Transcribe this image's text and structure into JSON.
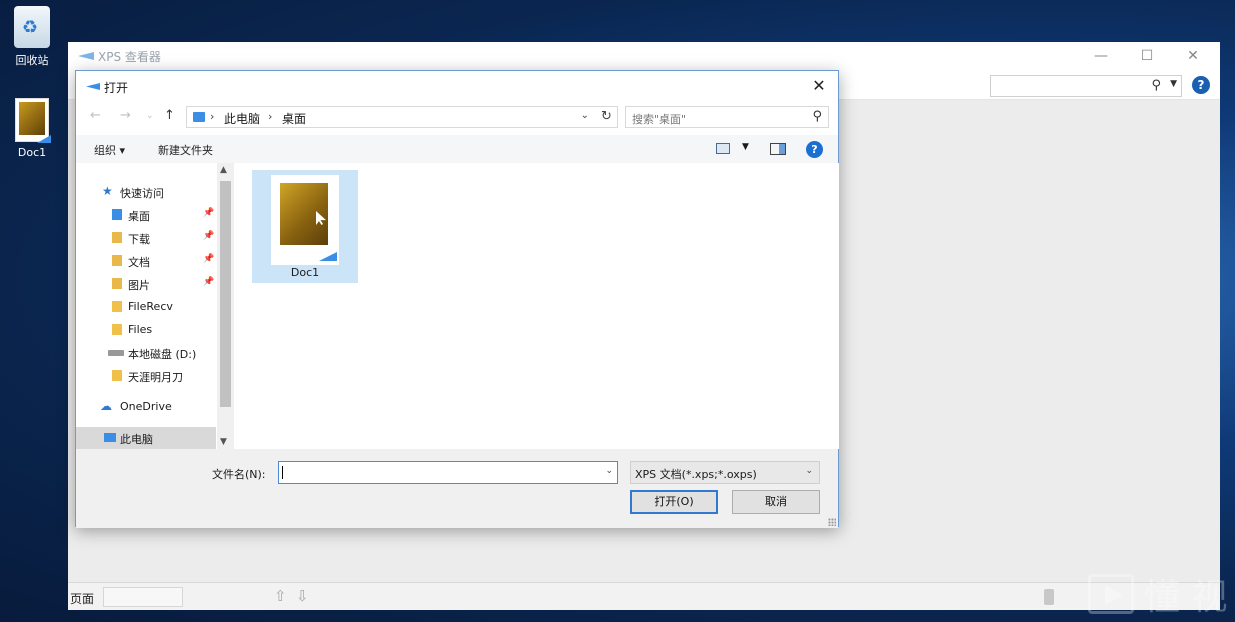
{
  "desktop": {
    "recycle_bin_label": "回收站",
    "doc_label": "Doc1"
  },
  "xps_window": {
    "title": "XPS 查看器",
    "status_page_label": "页面"
  },
  "dialog": {
    "title": "打开",
    "address": {
      "crumbs": [
        "此电脑",
        "桌面"
      ]
    },
    "search_placeholder": "搜索\"桌面\"",
    "toolbar": {
      "organize": "组织 ▾",
      "new_folder": "新建文件夹"
    },
    "sidebar": {
      "items": [
        {
          "label": "快速访问",
          "icon": "star-icon",
          "pinned": false
        },
        {
          "label": "桌面",
          "icon": "desktop-folder-icon",
          "pinned": true
        },
        {
          "label": "下载",
          "icon": "download-folder-icon",
          "pinned": true
        },
        {
          "label": "文档",
          "icon": "documents-folder-icon",
          "pinned": true
        },
        {
          "label": "图片",
          "icon": "pictures-folder-icon",
          "pinned": true
        },
        {
          "label": "FileRecv",
          "icon": "folder-icon",
          "pinned": false
        },
        {
          "label": "Files",
          "icon": "folder-icon",
          "pinned": false
        },
        {
          "label": "本地磁盘 (D:)",
          "icon": "drive-icon",
          "pinned": false
        },
        {
          "label": "天涯明月刀",
          "icon": "folder-icon",
          "pinned": false
        },
        {
          "label": "OneDrive",
          "icon": "cloud-icon",
          "pinned": false
        },
        {
          "label": "此电脑",
          "icon": "computer-icon",
          "pinned": false
        }
      ],
      "selected": "此电脑"
    },
    "files": [
      {
        "name": "Doc1",
        "icon": "xps-document-icon"
      }
    ],
    "filename_label": "文件名(N):",
    "filename_value": "",
    "filetype_value": "XPS 文档(*.xps;*.oxps)",
    "open_button": "打开(O)",
    "cancel_button": "取消"
  },
  "watermark": {
    "text": "懂 视"
  },
  "colors": {
    "accent": "#2f7ad0",
    "selection": "#cce4f7",
    "desktop_bg": "#0f3a78"
  }
}
